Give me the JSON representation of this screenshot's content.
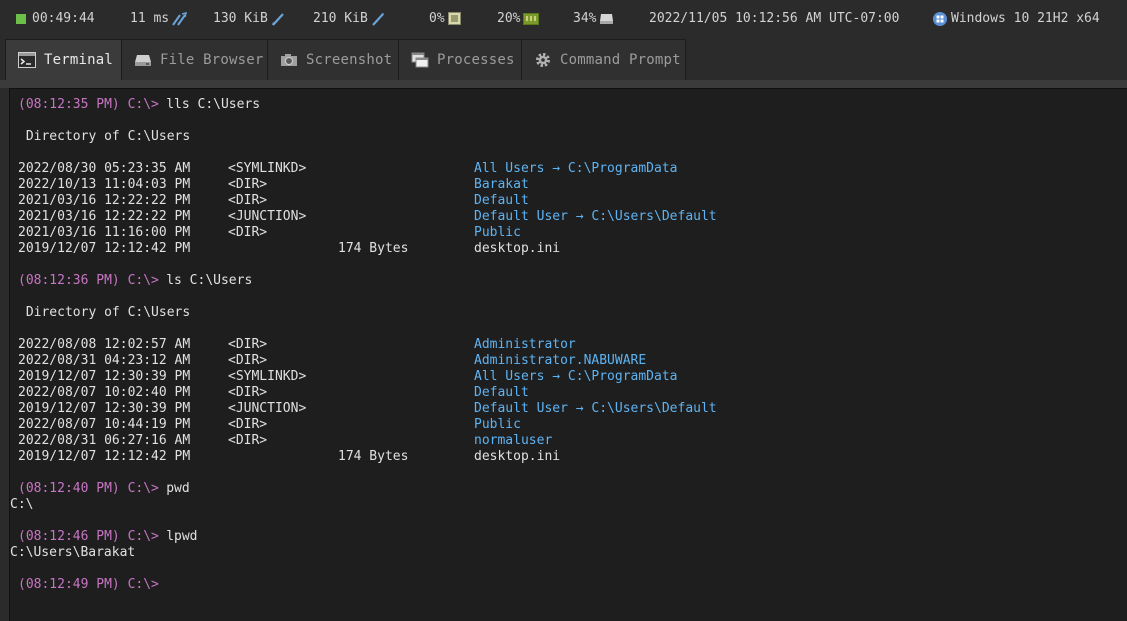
{
  "status_bar": {
    "uptime": "00:49:44",
    "latency": "11 ms",
    "download": "130 KiB",
    "upload": "210 KiB",
    "cpu": "0%",
    "memory": "20%",
    "disk": "34%",
    "datetime": "2022/11/05 10:12:56 AM UTC-07:00",
    "os": "Windows 10 21H2 x64",
    "accent_color": "#6cc04a",
    "icons": [
      "status-square-icon",
      "latency-icon",
      "download-icon",
      "upload-icon",
      "cpu-chip-icon",
      "memory-icon",
      "disk-icon",
      "windows-logo-icon"
    ]
  },
  "tabs": [
    {
      "label": "Terminal",
      "icon": "terminal-icon",
      "active": true
    },
    {
      "label": "File Browser",
      "icon": "drive-icon",
      "active": false
    },
    {
      "label": "Screenshot",
      "icon": "camera-icon",
      "active": false
    },
    {
      "label": "Processes",
      "icon": "windows-icon",
      "active": false
    },
    {
      "label": "Command Prompt",
      "icon": "gear-icon",
      "active": false
    }
  ],
  "terminal": {
    "colors": {
      "prompt": "#c875c4",
      "link": "#5eb3f2",
      "text": "#e0e0e0"
    },
    "blocks": [
      {
        "prompt": "(08:12:35 PM) C:\\>",
        "command": "lls C:\\Users",
        "heading": " Directory of C:\\Users",
        "entries": [
          {
            "date": "2022/08/30 05:23:35 AM",
            "type": "<SYMLINKD>",
            "size": "",
            "name": "All Users → C:\\ProgramData",
            "link": true
          },
          {
            "date": "2022/10/13 11:04:03 PM",
            "type": "<DIR>",
            "size": "",
            "name": "Barakat",
            "link": true
          },
          {
            "date": "2021/03/16 12:22:22 PM",
            "type": "<DIR>",
            "size": "",
            "name": "Default",
            "link": true
          },
          {
            "date": "2021/03/16 12:22:22 PM",
            "type": "<JUNCTION>",
            "size": "",
            "name": "Default User → C:\\Users\\Default",
            "link": true
          },
          {
            "date": "2021/03/16 11:16:00 PM",
            "type": "<DIR>",
            "size": "",
            "name": "Public",
            "link": true
          },
          {
            "date": "2019/12/07 12:12:42 PM",
            "type": "",
            "size": "174 Bytes",
            "name": "desktop.ini",
            "link": false
          }
        ]
      },
      {
        "prompt": "(08:12:36 PM) C:\\>",
        "command": "ls C:\\Users",
        "heading": " Directory of C:\\Users",
        "entries": [
          {
            "date": "2022/08/08 12:02:57 AM",
            "type": "<DIR>",
            "size": "",
            "name": "Administrator",
            "link": true
          },
          {
            "date": "2022/08/31 04:23:12 AM",
            "type": "<DIR>",
            "size": "",
            "name": "Administrator.NABUWARE",
            "link": true
          },
          {
            "date": "2019/12/07 12:30:39 PM",
            "type": "<SYMLINKD>",
            "size": "",
            "name": "All Users → C:\\ProgramData",
            "link": true
          },
          {
            "date": "2022/08/07 10:02:40 PM",
            "type": "<DIR>",
            "size": "",
            "name": "Default",
            "link": true
          },
          {
            "date": "2019/12/07 12:30:39 PM",
            "type": "<JUNCTION>",
            "size": "",
            "name": "Default User → C:\\Users\\Default",
            "link": true
          },
          {
            "date": "2022/08/07 10:44:19 PM",
            "type": "<DIR>",
            "size": "",
            "name": "Public",
            "link": true
          },
          {
            "date": "2022/08/31 06:27:16 AM",
            "type": "<DIR>",
            "size": "",
            "name": "normaluser",
            "link": true
          },
          {
            "date": "2019/12/07 12:12:42 PM",
            "type": "",
            "size": "174 Bytes",
            "name": "desktop.ini",
            "link": false
          }
        ]
      },
      {
        "prompt": "(08:12:40 PM) C:\\>",
        "command": "pwd",
        "output": "C:\\"
      },
      {
        "prompt": "(08:12:46 PM) C:\\>",
        "command": "lpwd",
        "output": "C:\\Users\\Barakat"
      },
      {
        "prompt": "(08:12:49 PM) C:\\>",
        "command": ""
      }
    ]
  }
}
